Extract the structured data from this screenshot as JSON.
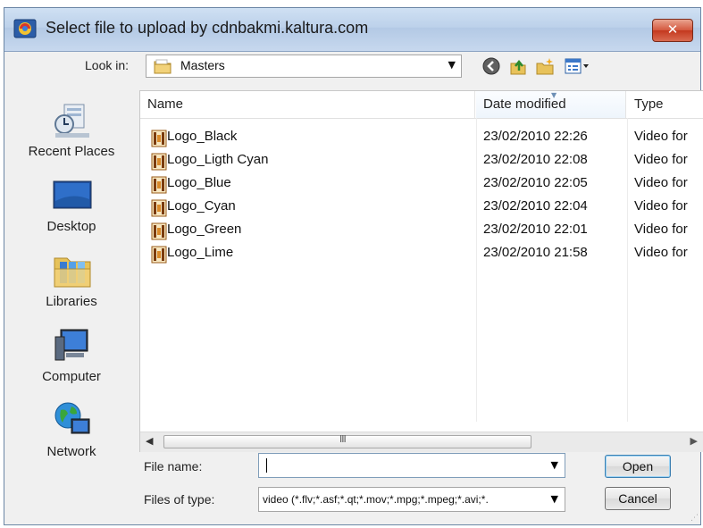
{
  "window": {
    "title": "Select file to upload by cdnbakmi.kaltura.com",
    "close_label": "✕"
  },
  "lookin": {
    "label": "Look in:",
    "value": "Masters"
  },
  "places": [
    {
      "label": "Recent Places",
      "icon": "recent-places-icon"
    },
    {
      "label": "Desktop",
      "icon": "desktop-icon"
    },
    {
      "label": "Libraries",
      "icon": "libraries-icon"
    },
    {
      "label": "Computer",
      "icon": "computer-icon"
    },
    {
      "label": "Network",
      "icon": "network-icon"
    }
  ],
  "columns": {
    "name": "Name",
    "date": "Date modified",
    "type": "Type"
  },
  "files": [
    {
      "name": "Logo_Black",
      "date": "23/02/2010 22:26",
      "type": "Video for"
    },
    {
      "name": "Logo_Ligth Cyan",
      "date": "23/02/2010 22:08",
      "type": "Video for"
    },
    {
      "name": "Logo_Blue",
      "date": "23/02/2010 22:05",
      "type": "Video for"
    },
    {
      "name": "Logo_Cyan",
      "date": "23/02/2010 22:04",
      "type": "Video for"
    },
    {
      "name": "Logo_Green",
      "date": "23/02/2010 22:01",
      "type": "Video for"
    },
    {
      "name": "Logo_Lime",
      "date": "23/02/2010 21:58",
      "type": "Video for"
    }
  ],
  "scroll": {
    "grip": "III"
  },
  "filename": {
    "label": "File name:",
    "value": ""
  },
  "filetype": {
    "label": "Files of type:",
    "value": "video (*.flv;*.asf;*.qt;*.mov;*.mpg;*.mpeg;*.avi;*."
  },
  "buttons": {
    "open": "Open",
    "cancel": "Cancel"
  }
}
